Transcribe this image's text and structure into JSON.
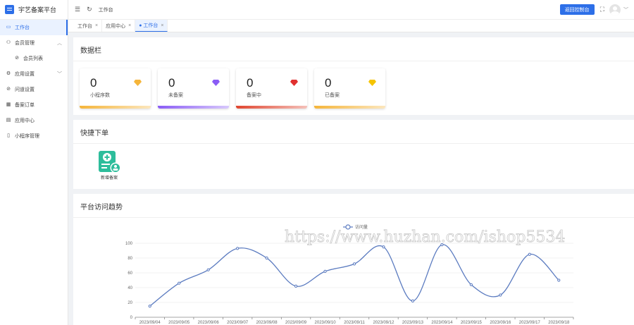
{
  "app": {
    "title": "宇艺备案平台"
  },
  "sidebar": {
    "items": [
      {
        "label": "工作台",
        "icon": "monitor-icon",
        "active": true
      },
      {
        "label": "会员管理",
        "icon": "user-icon",
        "expanded": true
      },
      {
        "label": "会员列表",
        "icon": "user-circle-icon",
        "sub": true
      },
      {
        "label": "应用设置",
        "icon": "gear-icon",
        "collapsed": true
      },
      {
        "label": "问道设置",
        "icon": "compass-icon"
      },
      {
        "label": "备案订单",
        "icon": "calendar-icon"
      },
      {
        "label": "应用中心",
        "icon": "grid-icon"
      },
      {
        "label": "小程序管理",
        "icon": "doc-icon"
      }
    ]
  },
  "header": {
    "breadcrumb": "工作台",
    "return_button": "返回控制台"
  },
  "tabs": [
    {
      "label": "工作台",
      "active": false
    },
    {
      "label": "应用中心",
      "active": false
    },
    {
      "label": "● 工作台",
      "active": true
    }
  ],
  "data_panel": {
    "title": "数据栏",
    "cards": [
      {
        "value": "0",
        "label": "小程序数",
        "color": "#f5b53a",
        "icon_color": "#f5b53a"
      },
      {
        "value": "0",
        "label": "未备案",
        "color": "#8a5cf5",
        "icon_color": "#8a5cf5"
      },
      {
        "value": "0",
        "label": "备案中",
        "color": "#e0452f",
        "icon_color": "#e0302f"
      },
      {
        "value": "0",
        "label": "已备案",
        "color": "#f5b53a",
        "icon_color": "#f5c400"
      }
    ]
  },
  "quick_panel": {
    "title": "快捷下单",
    "items": [
      {
        "label": "新增备案",
        "icon": "add-document-icon"
      }
    ]
  },
  "trend_panel": {
    "title": "平台访问趋势"
  },
  "watermark": "https://www.huzhan.com/ishop5534",
  "chart_data": {
    "type": "line",
    "title": "平台访问趋势",
    "legend": "访问量",
    "legend_position": "top-center",
    "x": [
      "2023/09/04",
      "2023/09/05",
      "2023/09/06",
      "2023/09/07",
      "2023/09/08",
      "2023/09/09",
      "2023/09/10",
      "2023/09/11",
      "2023/09/12",
      "2023/09/13",
      "2023/09/14",
      "2023/09/15",
      "2023/09/16",
      "2023/09/17",
      "2023/09/18"
    ],
    "series": [
      {
        "name": "访问量",
        "values": [
          15,
          46,
          64,
          93,
          80,
          42,
          62,
          72,
          95,
          22,
          98,
          44,
          30,
          85,
          50
        ]
      }
    ],
    "ylim": [
      0,
      100
    ],
    "yticks": [
      0,
      20,
      40,
      60,
      80,
      100
    ],
    "grid": true,
    "color": "#5b7bc0"
  }
}
